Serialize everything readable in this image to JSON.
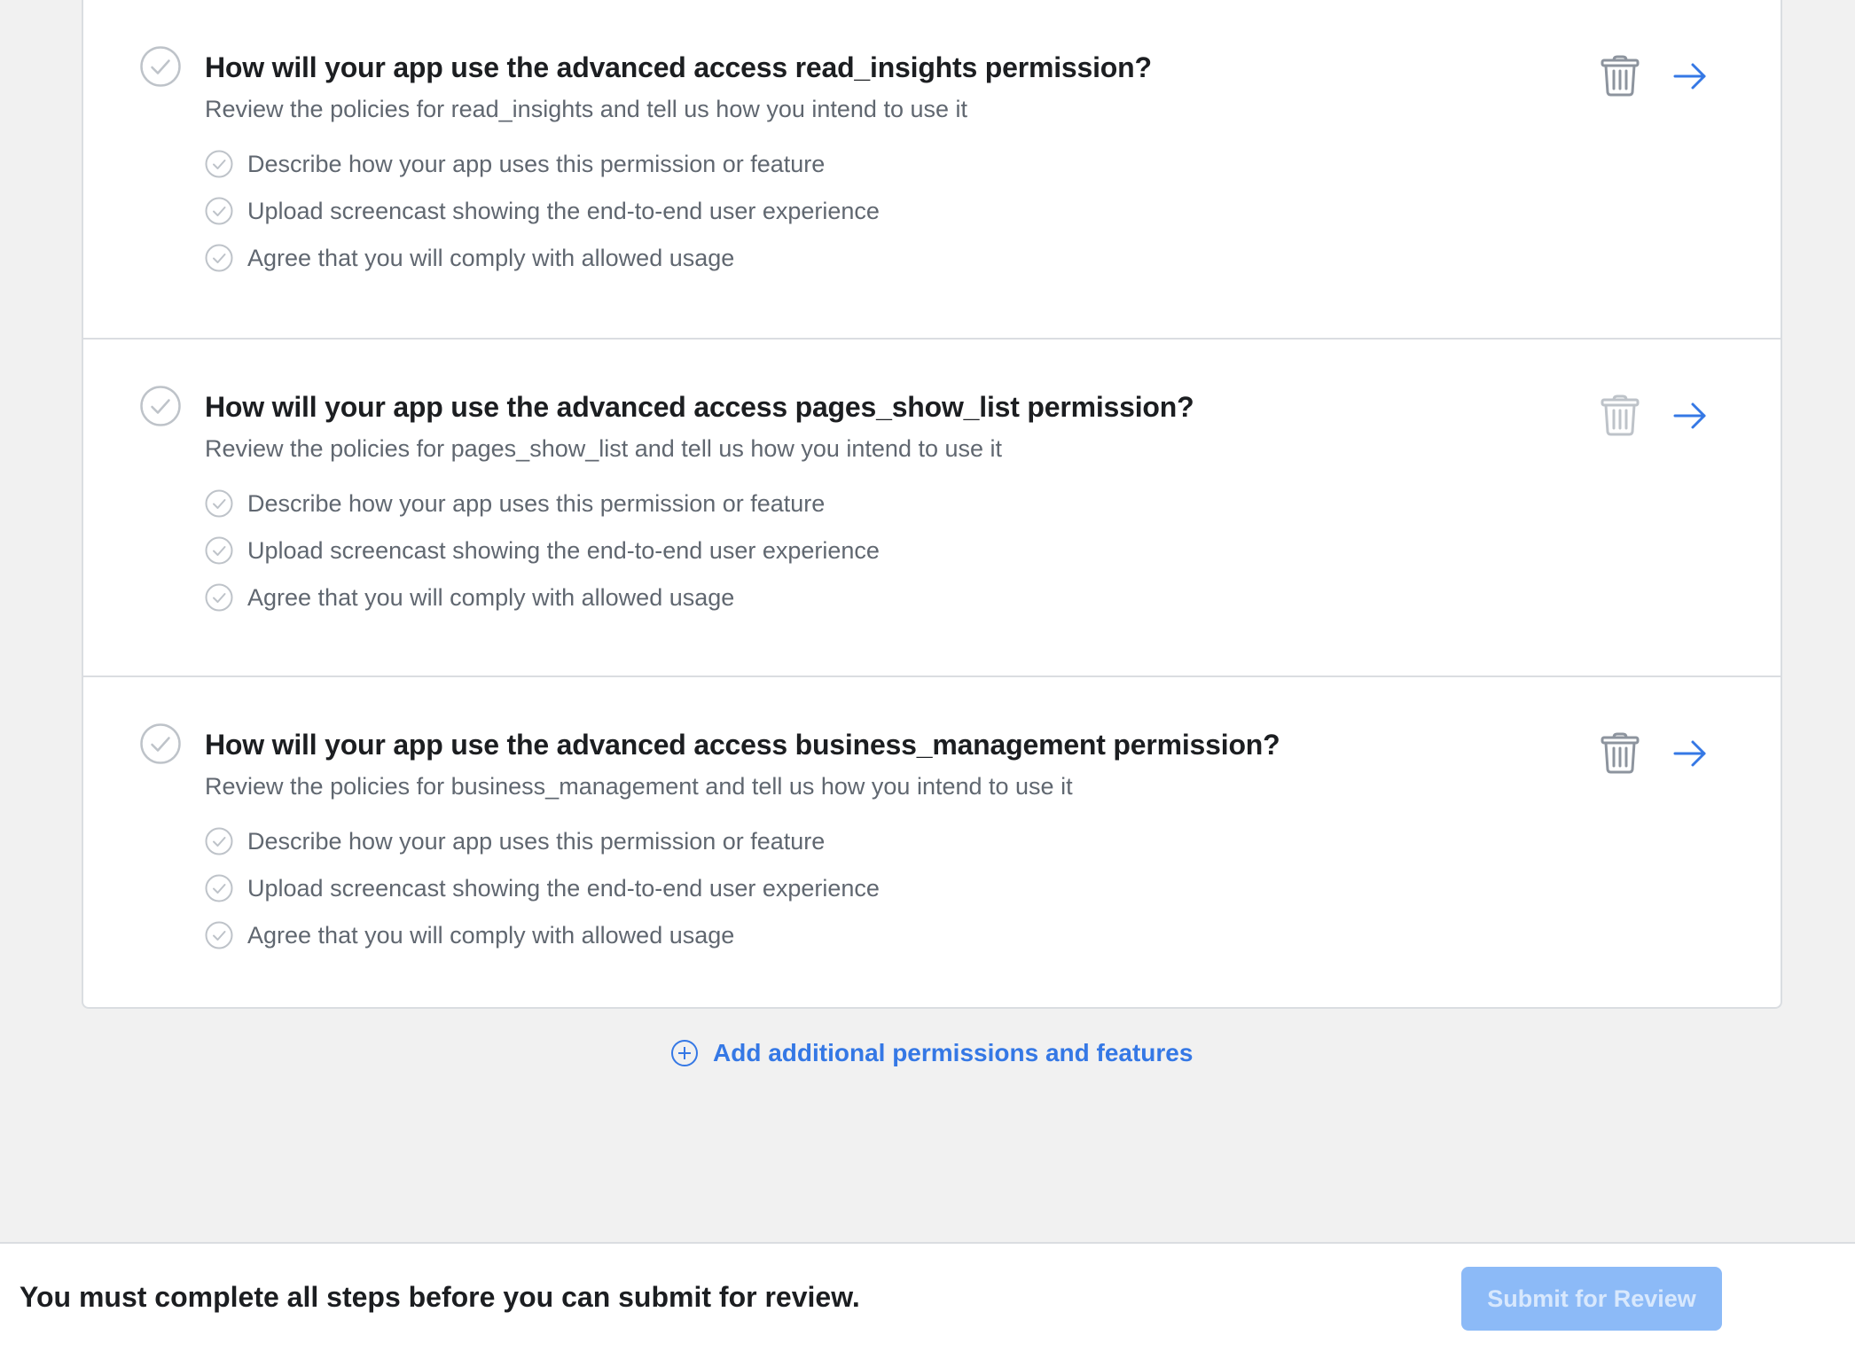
{
  "sections": [
    {
      "title": "How will your app use the advanced access read_insights permission?",
      "subtitle": "Review the policies for read_insights and tell us how you intend to use it",
      "items": [
        "Describe how your app uses this permission or feature",
        "Upload screencast showing the end-to-end user experience",
        "Agree that you will comply with allowed usage"
      ],
      "delete_icon": "trash-icon",
      "open_icon": "arrow-right-icon",
      "delete_color": "#8d949e"
    },
    {
      "title": "How will your app use the advanced access pages_show_list permission?",
      "subtitle": "Review the policies for pages_show_list and tell us how you intend to use it",
      "items": [
        "Describe how your app uses this permission or feature",
        "Upload screencast showing the end-to-end user experience",
        "Agree that you will comply with allowed usage"
      ],
      "delete_icon": "trash-icon",
      "open_icon": "arrow-right-icon",
      "delete_color": "#bec3c9"
    },
    {
      "title": "How will your app use the advanced access business_management permission?",
      "subtitle": "Review the policies for business_management and tell us how you intend to use it",
      "items": [
        "Describe how your app uses this permission or feature",
        "Upload screencast showing the end-to-end user experience",
        "Agree that you will comply with allowed usage"
      ],
      "delete_icon": "trash-icon",
      "open_icon": "arrow-right-icon",
      "delete_color": "#8d949e"
    }
  ],
  "add_link": {
    "label": "Add additional permissions and features",
    "icon": "plus-circle-icon"
  },
  "footer": {
    "message": "You must complete all steps before you can submit for review.",
    "submit_label": "Submit for Review",
    "submit_enabled": false
  },
  "colors": {
    "accent": "#3578e5",
    "check": "#bec3c9",
    "submit_disabled_bg": "#8cbaf7",
    "page_bg": "#f1f1f1"
  }
}
